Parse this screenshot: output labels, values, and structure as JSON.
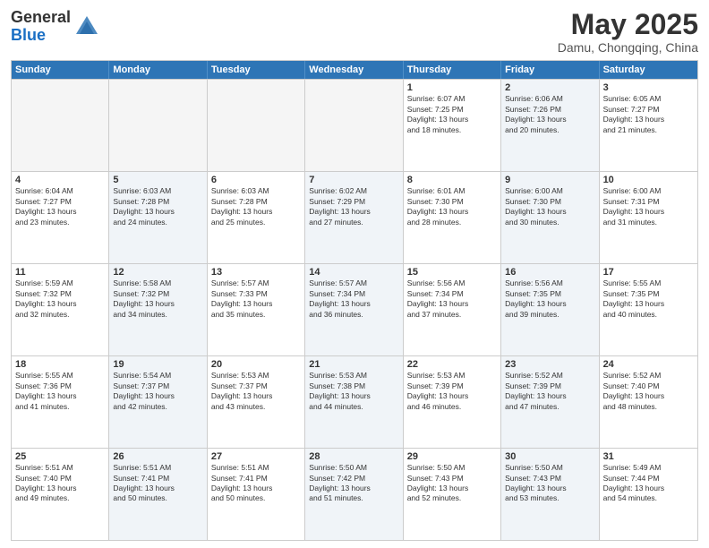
{
  "logo": {
    "general": "General",
    "blue": "Blue"
  },
  "title": "May 2025",
  "subtitle": "Damu, Chongqing, China",
  "weekdays": [
    "Sunday",
    "Monday",
    "Tuesday",
    "Wednesday",
    "Thursday",
    "Friday",
    "Saturday"
  ],
  "rows": [
    [
      {
        "day": "",
        "text": "",
        "empty": true
      },
      {
        "day": "",
        "text": "",
        "empty": true
      },
      {
        "day": "",
        "text": "",
        "empty": true
      },
      {
        "day": "",
        "text": "",
        "empty": true
      },
      {
        "day": "1",
        "text": "Sunrise: 6:07 AM\nSunset: 7:25 PM\nDaylight: 13 hours\nand 18 minutes."
      },
      {
        "day": "2",
        "text": "Sunrise: 6:06 AM\nSunset: 7:26 PM\nDaylight: 13 hours\nand 20 minutes.",
        "shaded": true
      },
      {
        "day": "3",
        "text": "Sunrise: 6:05 AM\nSunset: 7:27 PM\nDaylight: 13 hours\nand 21 minutes."
      }
    ],
    [
      {
        "day": "4",
        "text": "Sunrise: 6:04 AM\nSunset: 7:27 PM\nDaylight: 13 hours\nand 23 minutes."
      },
      {
        "day": "5",
        "text": "Sunrise: 6:03 AM\nSunset: 7:28 PM\nDaylight: 13 hours\nand 24 minutes.",
        "shaded": true
      },
      {
        "day": "6",
        "text": "Sunrise: 6:03 AM\nSunset: 7:28 PM\nDaylight: 13 hours\nand 25 minutes."
      },
      {
        "day": "7",
        "text": "Sunrise: 6:02 AM\nSunset: 7:29 PM\nDaylight: 13 hours\nand 27 minutes.",
        "shaded": true
      },
      {
        "day": "8",
        "text": "Sunrise: 6:01 AM\nSunset: 7:30 PM\nDaylight: 13 hours\nand 28 minutes."
      },
      {
        "day": "9",
        "text": "Sunrise: 6:00 AM\nSunset: 7:30 PM\nDaylight: 13 hours\nand 30 minutes.",
        "shaded": true
      },
      {
        "day": "10",
        "text": "Sunrise: 6:00 AM\nSunset: 7:31 PM\nDaylight: 13 hours\nand 31 minutes."
      }
    ],
    [
      {
        "day": "11",
        "text": "Sunrise: 5:59 AM\nSunset: 7:32 PM\nDaylight: 13 hours\nand 32 minutes."
      },
      {
        "day": "12",
        "text": "Sunrise: 5:58 AM\nSunset: 7:32 PM\nDaylight: 13 hours\nand 34 minutes.",
        "shaded": true
      },
      {
        "day": "13",
        "text": "Sunrise: 5:57 AM\nSunset: 7:33 PM\nDaylight: 13 hours\nand 35 minutes."
      },
      {
        "day": "14",
        "text": "Sunrise: 5:57 AM\nSunset: 7:34 PM\nDaylight: 13 hours\nand 36 minutes.",
        "shaded": true
      },
      {
        "day": "15",
        "text": "Sunrise: 5:56 AM\nSunset: 7:34 PM\nDaylight: 13 hours\nand 37 minutes."
      },
      {
        "day": "16",
        "text": "Sunrise: 5:56 AM\nSunset: 7:35 PM\nDaylight: 13 hours\nand 39 minutes.",
        "shaded": true
      },
      {
        "day": "17",
        "text": "Sunrise: 5:55 AM\nSunset: 7:35 PM\nDaylight: 13 hours\nand 40 minutes."
      }
    ],
    [
      {
        "day": "18",
        "text": "Sunrise: 5:55 AM\nSunset: 7:36 PM\nDaylight: 13 hours\nand 41 minutes."
      },
      {
        "day": "19",
        "text": "Sunrise: 5:54 AM\nSunset: 7:37 PM\nDaylight: 13 hours\nand 42 minutes.",
        "shaded": true
      },
      {
        "day": "20",
        "text": "Sunrise: 5:53 AM\nSunset: 7:37 PM\nDaylight: 13 hours\nand 43 minutes."
      },
      {
        "day": "21",
        "text": "Sunrise: 5:53 AM\nSunset: 7:38 PM\nDaylight: 13 hours\nand 44 minutes.",
        "shaded": true
      },
      {
        "day": "22",
        "text": "Sunrise: 5:53 AM\nSunset: 7:39 PM\nDaylight: 13 hours\nand 46 minutes."
      },
      {
        "day": "23",
        "text": "Sunrise: 5:52 AM\nSunset: 7:39 PM\nDaylight: 13 hours\nand 47 minutes.",
        "shaded": true
      },
      {
        "day": "24",
        "text": "Sunrise: 5:52 AM\nSunset: 7:40 PM\nDaylight: 13 hours\nand 48 minutes."
      }
    ],
    [
      {
        "day": "25",
        "text": "Sunrise: 5:51 AM\nSunset: 7:40 PM\nDaylight: 13 hours\nand 49 minutes."
      },
      {
        "day": "26",
        "text": "Sunrise: 5:51 AM\nSunset: 7:41 PM\nDaylight: 13 hours\nand 50 minutes.",
        "shaded": true
      },
      {
        "day": "27",
        "text": "Sunrise: 5:51 AM\nSunset: 7:41 PM\nDaylight: 13 hours\nand 50 minutes."
      },
      {
        "day": "28",
        "text": "Sunrise: 5:50 AM\nSunset: 7:42 PM\nDaylight: 13 hours\nand 51 minutes.",
        "shaded": true
      },
      {
        "day": "29",
        "text": "Sunrise: 5:50 AM\nSunset: 7:43 PM\nDaylight: 13 hours\nand 52 minutes."
      },
      {
        "day": "30",
        "text": "Sunrise: 5:50 AM\nSunset: 7:43 PM\nDaylight: 13 hours\nand 53 minutes.",
        "shaded": true
      },
      {
        "day": "31",
        "text": "Sunrise: 5:49 AM\nSunset: 7:44 PM\nDaylight: 13 hours\nand 54 minutes."
      }
    ]
  ]
}
